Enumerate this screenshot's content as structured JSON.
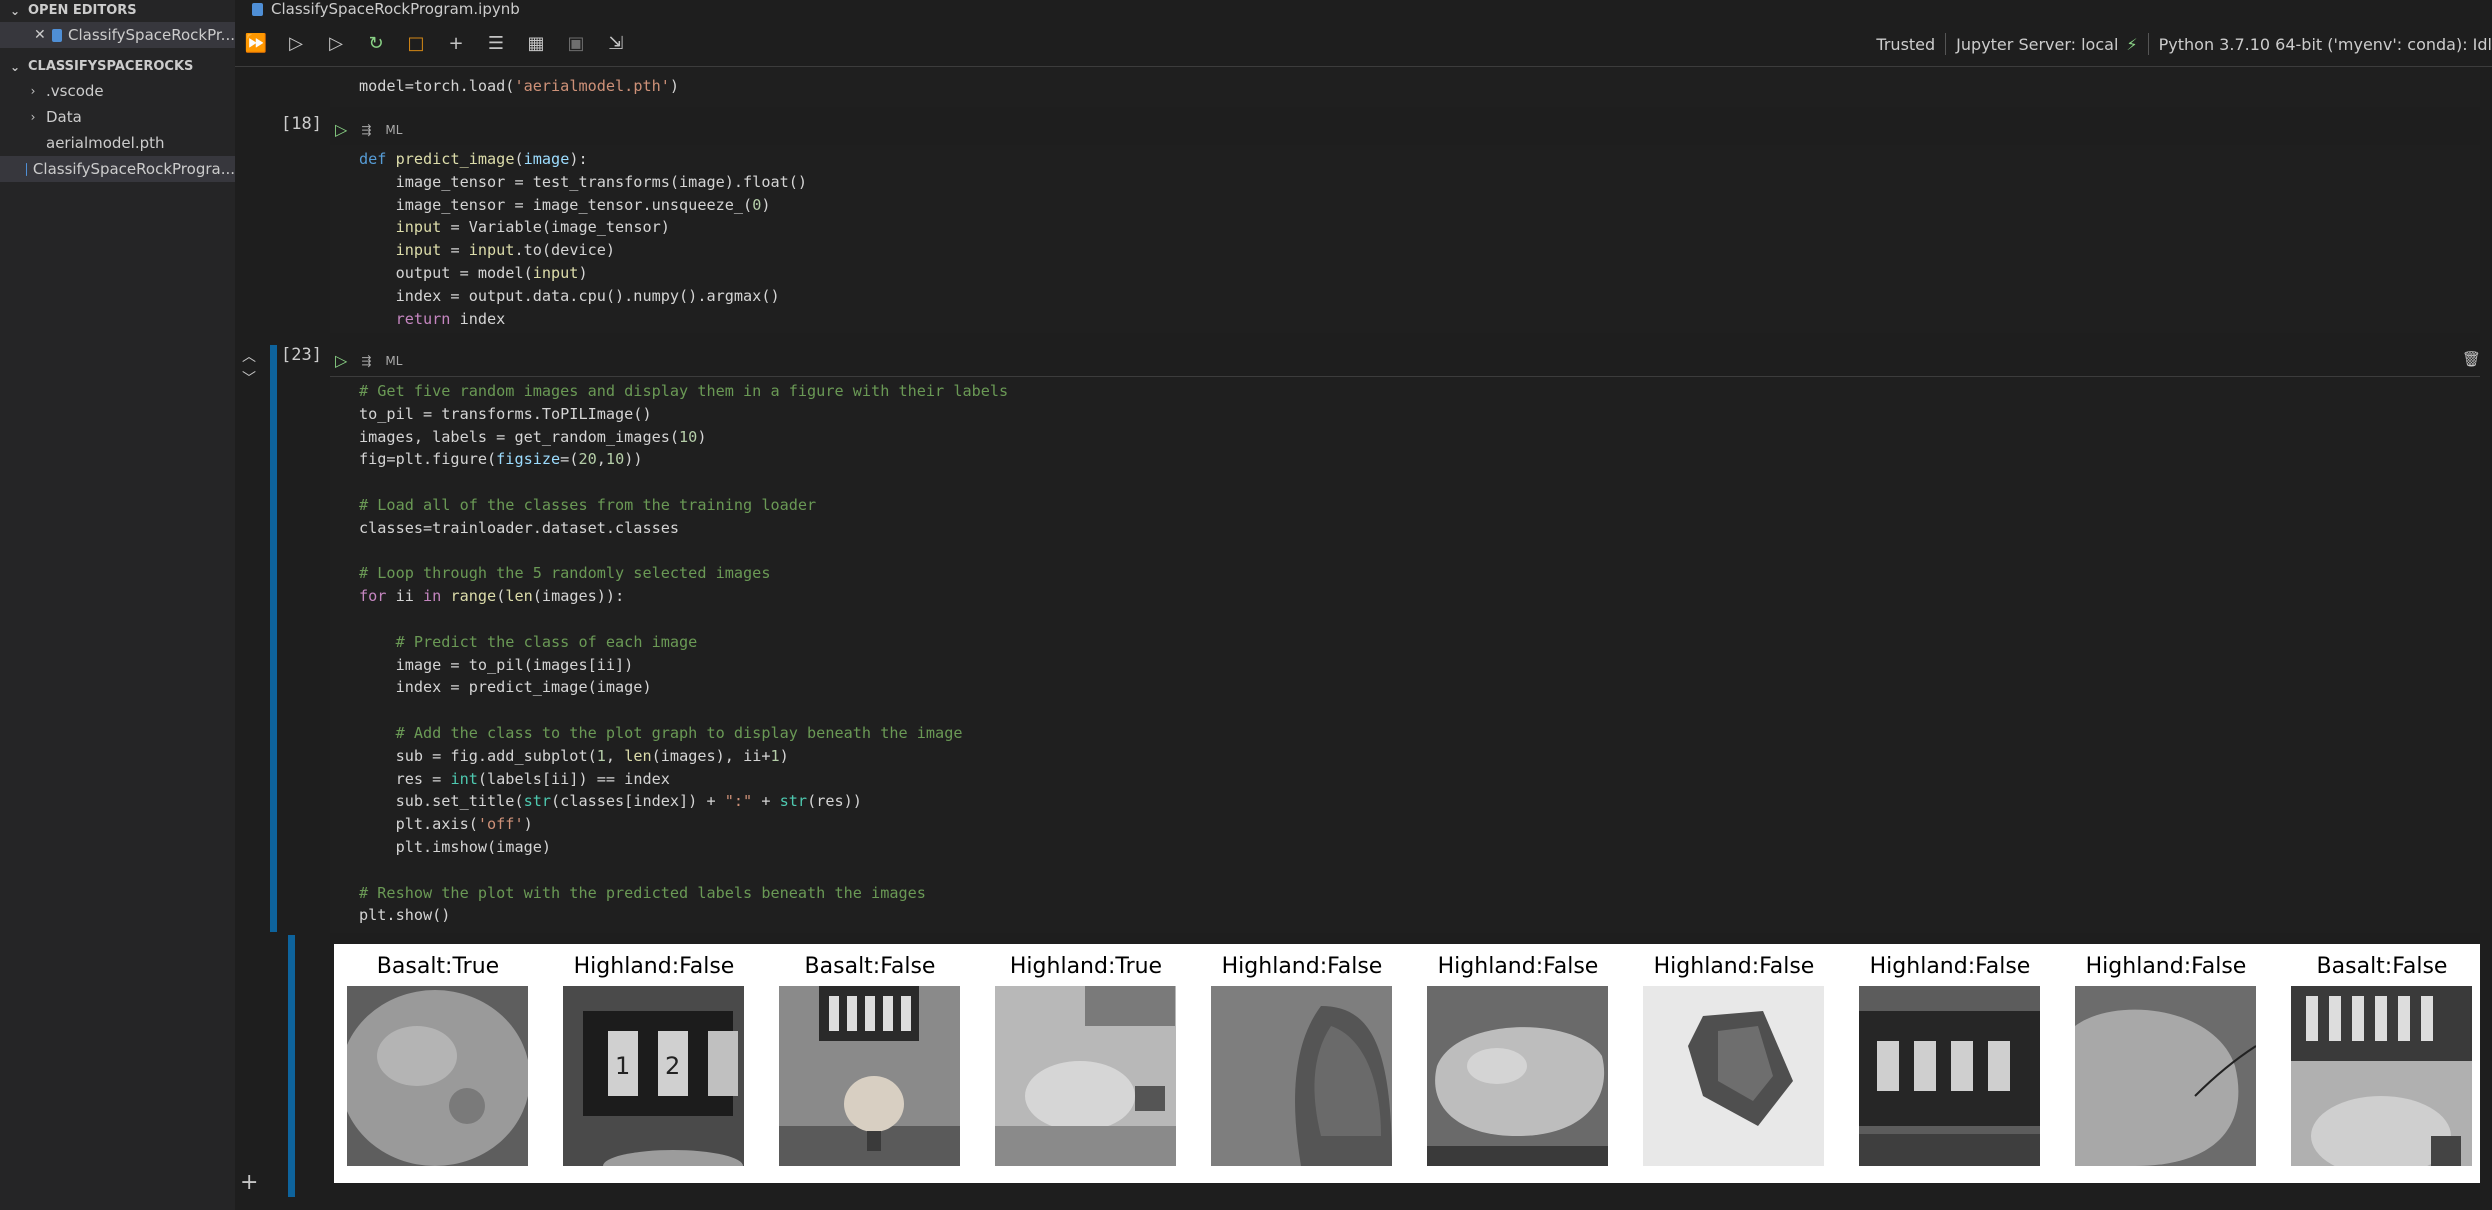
{
  "explorer": {
    "open_editors_label": "OPEN EDITORS",
    "open_editor_file": "ClassifySpaceRockPr...",
    "folder_label": "CLASSIFYSPACEROCKS",
    "items": [
      {
        "label": ".vscode",
        "kind": "folder"
      },
      {
        "label": "Data",
        "kind": "folder"
      },
      {
        "label": "aerialmodel.pth",
        "kind": "file"
      },
      {
        "label": "ClassifySpaceRockProgra...",
        "kind": "notebook"
      }
    ]
  },
  "tab": {
    "title": "ClassifySpaceRockProgram.ipynb"
  },
  "status": {
    "trusted": "Trusted",
    "server": "Jupyter Server: local",
    "kernel": "Python 3.7.10 64-bit ('myenv': conda): Idl"
  },
  "cells": [
    {
      "exec": "",
      "lines": [
        "model=torch.load('aerialmodel.pth')"
      ]
    },
    {
      "exec": "[18]",
      "lines": [
        "def predict_image(image):",
        "    image_tensor = test_transforms(image).float()",
        "    image_tensor = image_tensor.unsqueeze_(0)",
        "    input = Variable(image_tensor)",
        "    input = input.to(device)",
        "    output = model(input)",
        "    index = output.data.cpu().numpy().argmax()",
        "    return index"
      ]
    },
    {
      "exec": "[23]",
      "lines": [
        "# Get five random images and display them in a figure with their labels",
        "to_pil = transforms.ToPILImage()",
        "images, labels = get_random_images(10)",
        "fig=plt.figure(figsize=(20,10))",
        "",
        "# Load all of the classes from the training loader",
        "classes=trainloader.dataset.classes",
        "",
        "# Loop through the 5 randomly selected images",
        "for ii in range(len(images)):",
        "",
        "    # Predict the class of each image",
        "    image = to_pil(images[ii])",
        "    index = predict_image(image)",
        "",
        "    # Add the class to the plot graph to display beneath the image",
        "    sub = fig.add_subplot(1, len(images), ii+1)",
        "    res = int(labels[ii]) == index",
        "    sub.set_title(str(classes[index]) + \":\" + str(res))",
        "    plt.axis('off')",
        "    plt.imshow(image)",
        "",
        "# Reshow the plot with the predicted labels beneath the images",
        "plt.show()"
      ]
    }
  ],
  "cell_lang": "ML",
  "output": {
    "titles": [
      "Basalt:True",
      "Highland:False",
      "Basalt:False",
      "Highland:True",
      "Highland:False",
      "Highland:False",
      "Highland:False",
      "Highland:False",
      "Highland:False",
      "Basalt:False"
    ],
    "thumbnails": [
      "rock-closeup",
      "sample-counter",
      "rock-on-stand",
      "rock-with-label",
      "rock-edge",
      "large-rock",
      "rock-fragment",
      "sample-counter",
      "rock-with-wire",
      "counter-and-rock"
    ]
  }
}
